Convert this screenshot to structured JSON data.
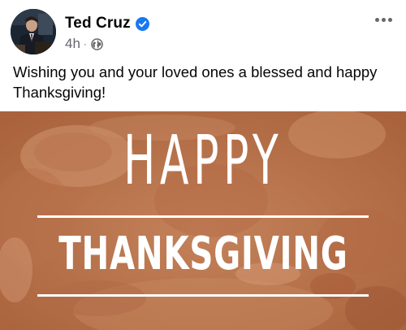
{
  "post": {
    "author": {
      "name": "Ted Cruz",
      "verified": true
    },
    "timestamp": "4h",
    "separator": "·",
    "audience_icon": "globe-icon",
    "more_icon": "more-options-icon",
    "text": "Wishing you and your loved ones a blessed and happy Thanksgiving!",
    "image": {
      "headline": "HAPPY",
      "subheadline": "THANKSGIVING"
    }
  },
  "colors": {
    "verified_blue": "#1877f2",
    "meta_gray": "#65676b",
    "image_tint": "#c07a4e"
  }
}
